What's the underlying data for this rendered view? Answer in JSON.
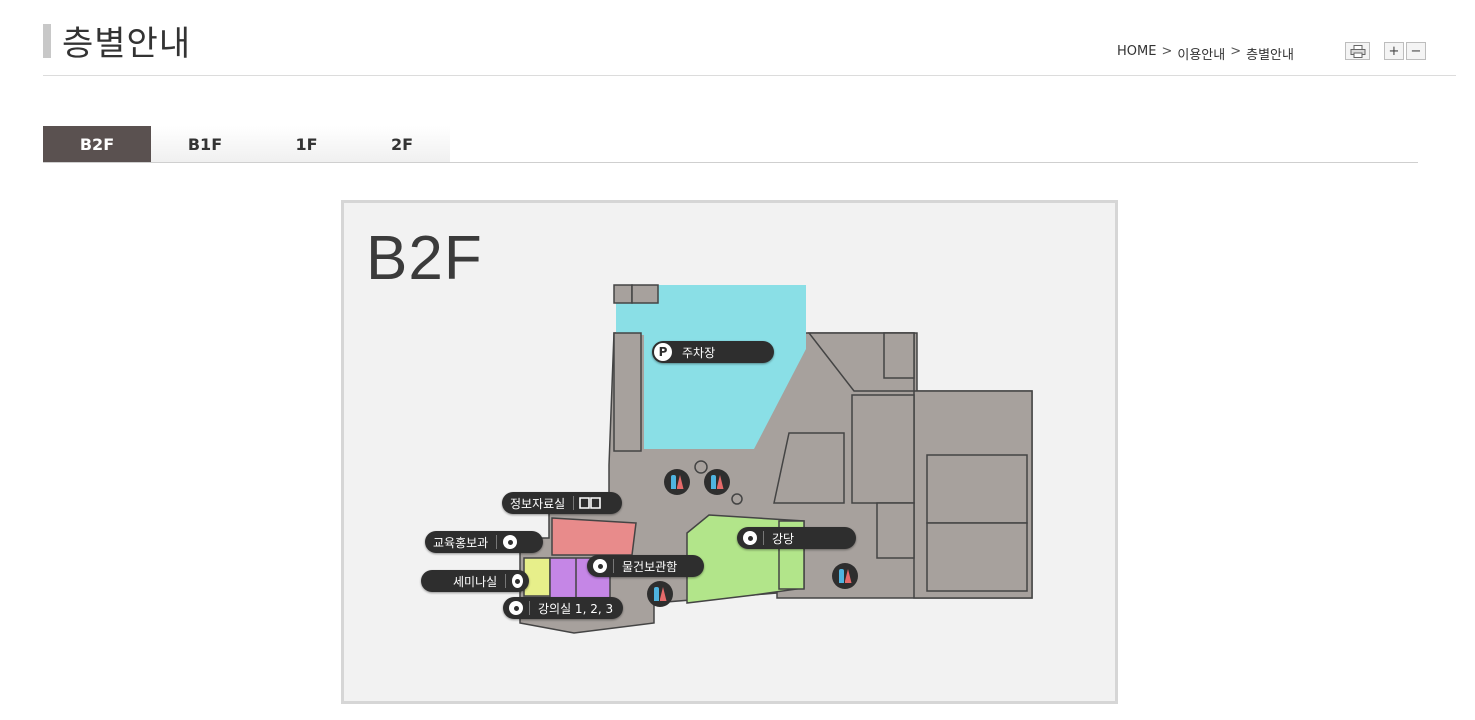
{
  "header": {
    "title": "층별안내",
    "breadcrumb": [
      "HOME",
      "이용안내",
      "층별안내"
    ],
    "breadcrumb_sep": ">",
    "tools": {
      "print_icon": "printer-icon",
      "zoom_in": "+",
      "zoom_out": "−"
    }
  },
  "tabs": [
    {
      "label": "B2F",
      "active": true
    },
    {
      "label": "B1F",
      "active": false
    },
    {
      "label": "1F",
      "active": false
    },
    {
      "label": "2F",
      "active": false
    }
  ],
  "map": {
    "floor_label": "B2F",
    "labels": {
      "parking": "주차장",
      "parking_icon": "P",
      "info_room": "정보자료실",
      "education": "교육홍보과",
      "seminar": "세미나실",
      "lecture": "강의실 1, 2, 3",
      "water_hall": "물건보관함",
      "auditorium": "강당"
    },
    "colors": {
      "parking": "#8adfe6",
      "info_room": "#e88b8b",
      "seminar": "#c586e6",
      "seminar_yellow": "#e7ef8a",
      "auditorium": "#b2e58a",
      "building": "#a7a19d",
      "outline": "#444444"
    }
  }
}
